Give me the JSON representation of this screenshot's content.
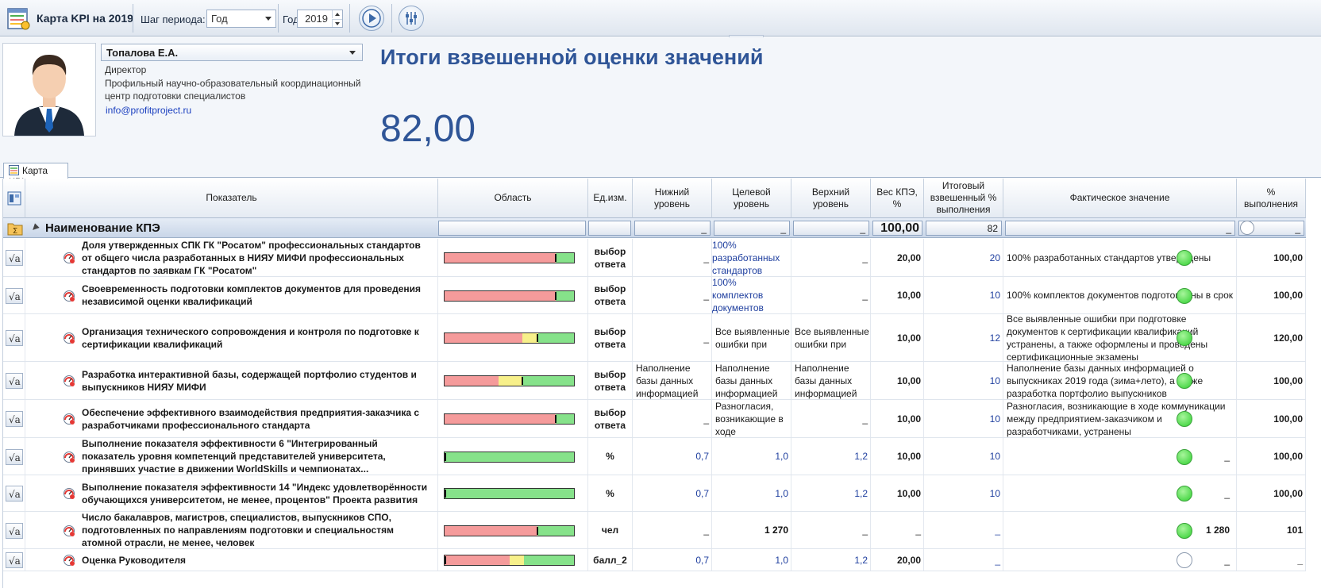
{
  "toolbar": {
    "title": "Карта KPI на 2019",
    "period_step_label": "Шаг периода:",
    "period_step_value": "Год",
    "year_label": "Год",
    "year_value": "2019",
    "collapse_label": "..."
  },
  "person": {
    "name": "Топалова Е.А.",
    "position": "Директор",
    "org_line1": "Профильный научно-образовательный координационный",
    "org_line2": "центр подготовки специалистов",
    "email": "info@profitproject.ru"
  },
  "summary": {
    "title": "Итоги взвешенной оценки значений",
    "score": "82,00"
  },
  "tabs": [
    {
      "label": "Карта KPI"
    }
  ],
  "grid": {
    "headers": {
      "indicator": "Показатель",
      "area": "Область",
      "unit": "Ед.изм.",
      "lower": "Нижний уровень",
      "target": "Целевой уровень",
      "upper": "Верхний уровень",
      "weight": "Вес КПЭ, %",
      "weighted": "Итоговый взвешенный % выполнения",
      "actual": "Фактическое значение",
      "percent": "% выполнения"
    },
    "group": {
      "title": "Наименование КПЭ",
      "weight_total": "100,00",
      "weighted_total": "82",
      "placeholder": "_"
    },
    "rows": [
      {
        "name": "Доля утвержденных СПК ГК \"Росатом\" профессиональных стандартов от общего числа разработанных в НИЯУ МИФИ профессиональных стандартов по заявкам ГК \"Росатом\"",
        "unit": "выбор ответа",
        "lower": "_",
        "target": "100% разработанных стандартов",
        "upper": "_",
        "weight": "20,00",
        "weighted": "20",
        "actual": "100% разработанных стандартов утверждены",
        "percent": "100,00",
        "status": "green",
        "bar_red": 0.86,
        "bar_yellow": 0,
        "marker": 0.86
      },
      {
        "name": "Своевременность подготовки комплектов документов для проведения независимой оценки квалификаций",
        "unit": "выбор ответа",
        "lower": "_",
        "target": "100% комплектов документов",
        "upper": "_",
        "weight": "10,00",
        "weighted": "10",
        "actual": "100% комплектов документов подготовлены в срок",
        "percent": "100,00",
        "status": "green",
        "bar_red": 0.86,
        "bar_yellow": 0,
        "marker": 0.86
      },
      {
        "name": "Организация технического сопровождения и контроля по подготовке к сертификации квалификаций",
        "unit": "выбор ответа",
        "lower": "_",
        "target": "Все выявленные ошибки при",
        "upper": "Все выявленные ошибки при",
        "weight": "10,00",
        "weighted": "12",
        "actual": "Все выявленные ошибки при подготовке документов к сертификации квалификаций устранены, а также оформлены и проведены сертификационные экзамены",
        "percent": "120,00",
        "status": "green",
        "bar_red": 0.6,
        "bar_yellow": 0.12,
        "marker": 0.72
      },
      {
        "name": "Разработка интерактивной базы, содержащей портфолио студентов и выпускников НИЯУ МИФИ",
        "unit": "выбор ответа",
        "lower": "Наполнение базы данных информацией",
        "target": "Наполнение базы данных информацией",
        "upper": "Наполнение базы данных информацией",
        "weight": "10,00",
        "weighted": "10",
        "actual": "Наполнение базы данных информацией о выпускниках 2019 года (зима+лето), а также разработка портфолио выпускников",
        "percent": "100,00",
        "status": "green",
        "bar_red": 0.42,
        "bar_yellow": 0.18,
        "marker": 0.6
      },
      {
        "name": "Обеспечение эффективного взаимодействия предприятия-заказчика с разработчиками профессионального стандарта",
        "unit": "выбор ответа",
        "lower": "_",
        "target": "Разногласия, возникающие в ходе",
        "upper": "_",
        "weight": "10,00",
        "weighted": "10",
        "actual": "Разногласия, возникающие в ходе коммуникации между предприятием-заказчиком и разработчиками, устранены",
        "percent": "100,00",
        "status": "green",
        "bar_red": 0.86,
        "bar_yellow": 0,
        "marker": 0.86
      },
      {
        "name": "Выполнение  показателя эффективности 6 \"Интегрированный показатель уровня компетенций представителей университета, принявших участие в движении WorldSkills и чемпионатах...",
        "unit": "%",
        "lower": "0,7",
        "target": "1,0",
        "upper": "1,2",
        "weight": "10,00",
        "weighted": "10",
        "actual": "_",
        "percent": "100,00",
        "status": "green",
        "bar_red": 0,
        "bar_yellow": 0,
        "marker": 0
      },
      {
        "name": "Выполнение показателя эффективности 14 \"Индекс удовлетворённости обучающихся университетом, не менее, процентов\" Проекта развития",
        "unit": "%",
        "lower": "0,7",
        "target": "1,0",
        "upper": "1,2",
        "weight": "10,00",
        "weighted": "10",
        "actual": "_",
        "percent": "100,00",
        "status": "green",
        "bar_red": 0,
        "bar_yellow": 0,
        "marker": 0
      },
      {
        "name": "Число бакалавров, магистров, специалистов, выпускников СПО, подготовленных по направлениям подготовки и специальностям атомной отрасли, не менее, человек",
        "unit": "чел",
        "lower": "_",
        "target": "1 270",
        "upper": "_",
        "weight": "_",
        "weighted": "_",
        "actual": "1 280",
        "percent": "101",
        "status": "green",
        "bar_red": 0.72,
        "bar_yellow": 0,
        "marker": 0.72
      },
      {
        "name": "Оценка Руководителя",
        "unit": "балл_2",
        "lower": "0,7",
        "target": "1,0",
        "upper": "1,2",
        "weight": "20,00",
        "weighted": "_",
        "actual": "_",
        "percent": "_",
        "status": "empty",
        "bar_red": 0.5,
        "bar_yellow": 0.11,
        "marker": 0
      }
    ]
  }
}
